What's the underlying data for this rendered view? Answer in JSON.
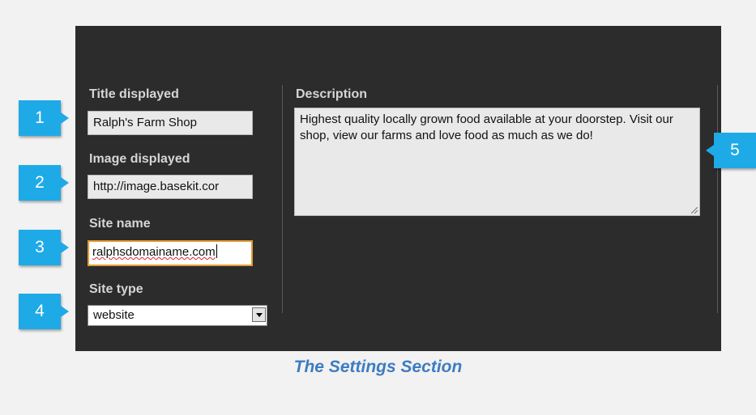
{
  "settings": {
    "title_label": "Title displayed",
    "title_value": "Ralph's Farm Shop",
    "image_label": "Image displayed",
    "image_value": "http://image.basekit.cor",
    "site_name_label": "Site name",
    "site_name_value": "ralphsdomainame.com",
    "site_type_label": "Site type",
    "site_type_value": "website",
    "description_label": "Description",
    "description_value": "Highest quality locally grown food available at your doorstep. Visit our shop, view our farms and love food as much as we do!"
  },
  "callouts": [
    "1",
    "2",
    "3",
    "4",
    "5"
  ],
  "caption": "The Settings Section",
  "colors": {
    "panel": "#2c2c2c",
    "callout": "#1eaae7",
    "caption": "#3d7cc2",
    "focus_border": "#e39b34"
  },
  "icons": [
    "chevron-down-icon",
    "resize-grip-icon"
  ]
}
